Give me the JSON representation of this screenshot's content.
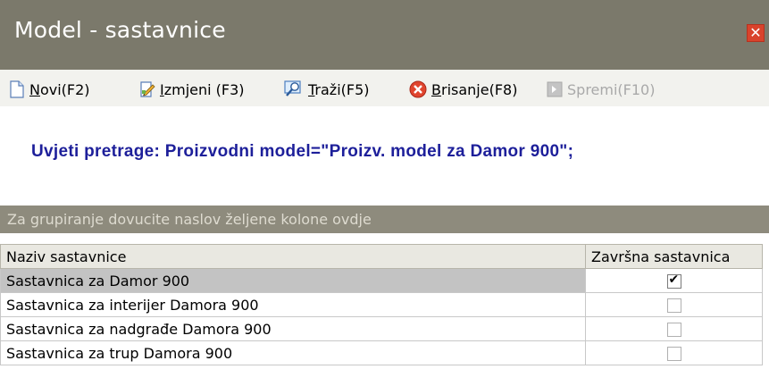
{
  "window": {
    "title": "Model - sastavnice",
    "close_icon": "close-icon",
    "colors": {
      "titlebar": "#7b796b",
      "close": "#d9432c",
      "criteria_text": "#1d1f9a"
    }
  },
  "toolbar": {
    "new": {
      "accel": "N",
      "rest": "ovi(F2)",
      "icon": "new-document-icon"
    },
    "edit": {
      "accel": "I",
      "rest": "zmjeni (F3)",
      "icon": "edit-icon"
    },
    "search": {
      "accel": "T",
      "rest": "raži(F5)",
      "icon": "search-icon"
    },
    "delete": {
      "accel": "B",
      "rest": "risanje(F8)",
      "icon": "delete-icon"
    },
    "save": {
      "label": "Spremi(F10)",
      "icon": "save-icon",
      "enabled": false
    }
  },
  "criteria": "Uvjeti pretrage: Proizvodni model=\"Proizv. model za Damor 900\";",
  "grid": {
    "group_hint": "Za grupiranje dovucite naslov željene kolone ovdje",
    "columns": [
      "Naziv sastavnice",
      "Završna sastavnica"
    ],
    "rows": [
      {
        "name": "Sastavnica za Damor 900",
        "final": true,
        "selected": true
      },
      {
        "name": "Sastavnica za interijer Damora 900",
        "final": false
      },
      {
        "name": "Sastavnica za nadgrađe Damora 900",
        "final": false
      },
      {
        "name": "Sastavnica za trup Damora 900",
        "final": false
      }
    ]
  }
}
